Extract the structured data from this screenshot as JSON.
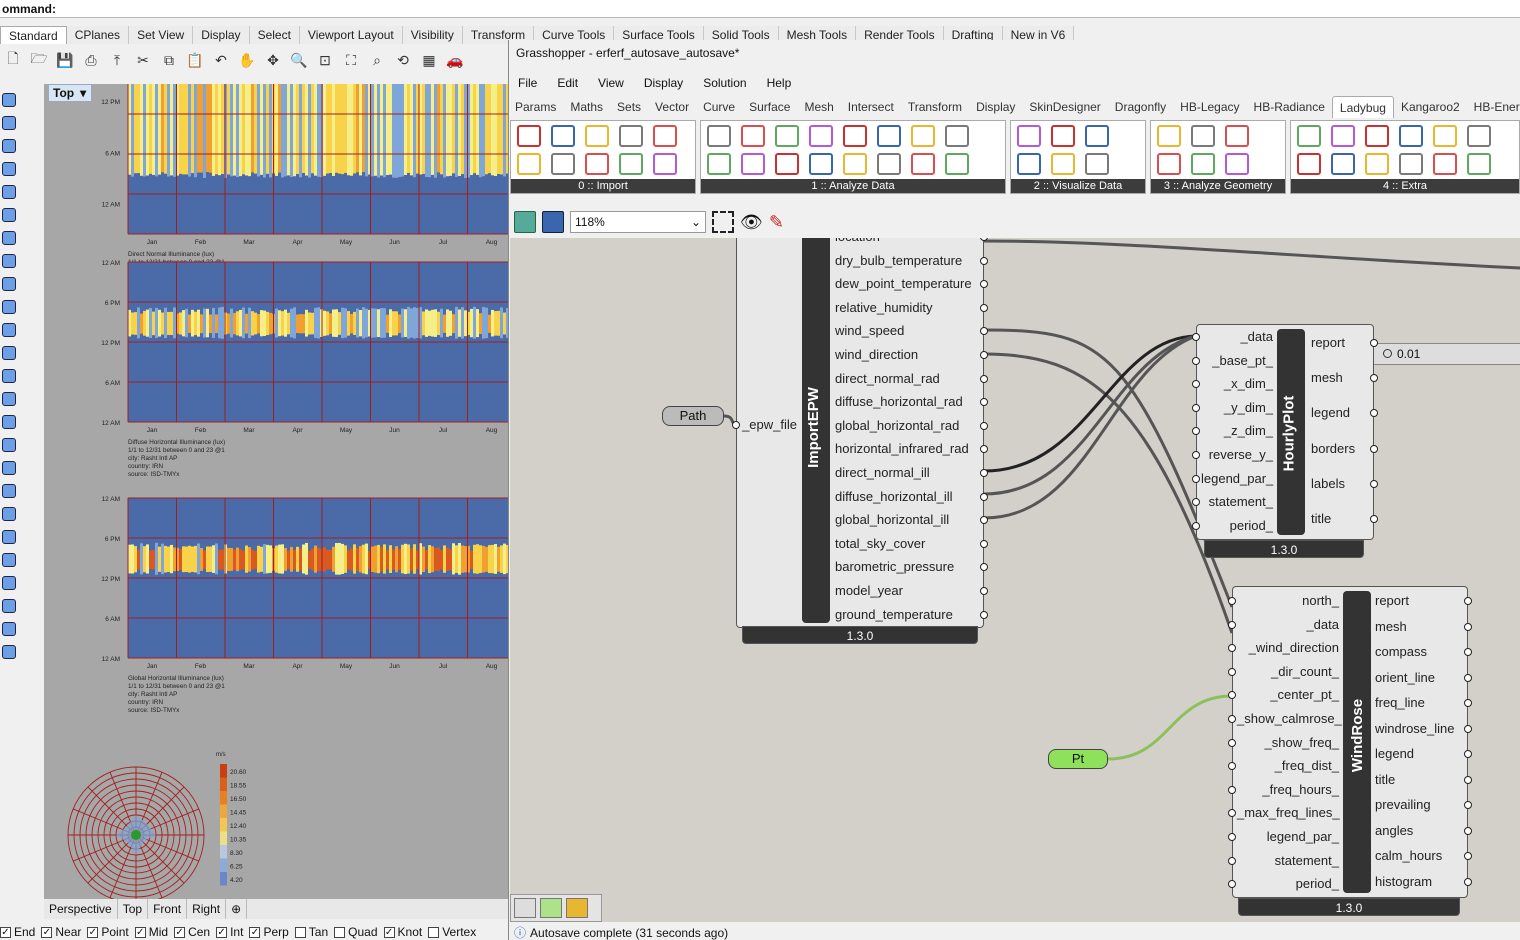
{
  "rhino": {
    "command_label": "ommand:",
    "tabs": [
      "Standard",
      "CPlanes",
      "Set View",
      "Display",
      "Select",
      "Viewport Layout",
      "Visibility",
      "Transform",
      "Curve Tools",
      "Surface Tools",
      "Solid Tools",
      "Mesh Tools",
      "Render Tools",
      "Drafting",
      "New in V6"
    ],
    "active_tab": "Standard",
    "viewport_name": "Top",
    "viewport_tabs": [
      "Perspective",
      "Top",
      "Front",
      "Right"
    ],
    "add_tab": "⊕",
    "osnaps": [
      {
        "label": "End",
        "checked": true
      },
      {
        "label": "Near",
        "checked": true
      },
      {
        "label": "Point",
        "checked": true
      },
      {
        "label": "Mid",
        "checked": true
      },
      {
        "label": "Cen",
        "checked": true
      },
      {
        "label": "Int",
        "checked": true
      },
      {
        "label": "Perp",
        "checked": true
      },
      {
        "label": "Tan",
        "checked": false
      },
      {
        "label": "Quad",
        "checked": false
      },
      {
        "label": "Knot",
        "checked": true
      },
      {
        "label": "Vertex",
        "checked": false
      }
    ],
    "hourly_plots": [
      {
        "ylabels": [
          "12 PM",
          "6 AM",
          "12 AM"
        ],
        "months": [
          "Jan",
          "Feb",
          "Mar",
          "Apr",
          "May",
          "Jun",
          "Jul",
          "Aug"
        ],
        "caption": [
          "Direct Normal Illuminance (lux)",
          "1/1 to 12/31 between 0 and 23 @1",
          "city: Rasht Intl AP",
          "country: IRN",
          "source: ISD-TMYx"
        ]
      },
      {
        "ylabels": [
          "12 AM",
          "6 PM",
          "12 PM",
          "6 AM",
          "12 AM"
        ],
        "months": [
          "Jan",
          "Feb",
          "Mar",
          "Apr",
          "May",
          "Jun",
          "Jul",
          "Aug"
        ],
        "caption": [
          "Diffuse Horizontal Illuminance (lux)",
          "1/1 to 12/31 between 0 and 23 @1",
          "city: Rasht Intl AP",
          "country: IRN",
          "source: ISD-TMYx"
        ]
      },
      {
        "ylabels": [
          "12 AM",
          "6 PM",
          "12 PM",
          "6 AM",
          "12 AM"
        ],
        "months": [
          "Jan",
          "Feb",
          "Mar",
          "Apr",
          "May",
          "Jun",
          "Jul",
          "Aug"
        ],
        "caption": [
          "Global Horizontal Illuminance (lux)",
          "1/1 to 12/31 between 0 and 23 @1",
          "city: Rasht Intl AP",
          "country: IRN",
          "source: ISD-TMYx"
        ]
      }
    ],
    "windrose_legend": {
      "unit": "m/s",
      "values": [
        "20.60",
        "18.55",
        "16.50",
        "14.45",
        "12.40",
        "10.35",
        "8.30",
        "6.25",
        "4.20"
      ]
    }
  },
  "gh": {
    "title": "Grasshopper - erferf_autosave_autosave*",
    "menu": [
      "File",
      "Edit",
      "View",
      "Display",
      "Solution",
      "Help"
    ],
    "tabs": [
      "Params",
      "Maths",
      "Sets",
      "Vector",
      "Curve",
      "Surface",
      "Mesh",
      "Intersect",
      "Transform",
      "Display",
      "SkinDesigner",
      "Dragonfly",
      "HB-Legacy",
      "HB-Radiance",
      "Ladybug",
      "Kangaroo2",
      "HB-Energy"
    ],
    "active_tab": "Ladybug",
    "ribbon_panels": [
      "0 :: Import",
      "1 :: Analyze Data",
      "2 :: Visualize Data",
      "3 :: Analyze Geometry",
      "4 :: Extra"
    ],
    "zoom": "118%",
    "status": "Autosave complete (31 seconds ago)",
    "components": {
      "path": "Path",
      "pt": "Pt",
      "slider_value": "0.01",
      "import_epw": {
        "name": "ImportEPW",
        "version": "1.3.0",
        "inputs": [
          "_epw_file"
        ],
        "outputs": [
          "location",
          "dry_bulb_temperature",
          "dew_point_temperature",
          "relative_humidity",
          "wind_speed",
          "wind_direction",
          "direct_normal_rad",
          "diffuse_horizontal_rad",
          "global_horizontal_rad",
          "horizontal_infrared_rad",
          "direct_normal_ill",
          "diffuse_horizontal_ill",
          "global_horizontal_ill",
          "total_sky_cover",
          "barometric_pressure",
          "model_year",
          "ground_temperature"
        ]
      },
      "hourly_plot": {
        "name": "HourlyPlot",
        "version": "1.3.0",
        "inputs": [
          "_data",
          "_base_pt_",
          "_x_dim_",
          "_y_dim_",
          "_z_dim_",
          "reverse_y_",
          "legend_par_",
          "statement_",
          "period_"
        ],
        "outputs": [
          "report",
          "mesh",
          "legend",
          "borders",
          "labels",
          "title"
        ]
      },
      "wind_rose": {
        "name": "WindRose",
        "version": "1.3.0",
        "inputs": [
          "north_",
          "_data",
          "_wind_direction",
          "_dir_count_",
          "_center_pt_",
          "_show_calmrose_",
          "_show_freq_",
          "_freq_dist_",
          "_freq_hours_",
          "_max_freq_lines_",
          "legend_par_",
          "statement_",
          "period_"
        ],
        "outputs": [
          "report",
          "mesh",
          "compass",
          "orient_line",
          "freq_line",
          "windrose_line",
          "legend",
          "title",
          "prevailing",
          "angles",
          "calm_hours",
          "histogram"
        ]
      }
    },
    "colors": {
      "canvas": "#d2d0c8",
      "component_dark": "#333333",
      "pt_green": "#8fe05a",
      "wire": "#555555",
      "wire_green": "#8cc05a"
    }
  }
}
